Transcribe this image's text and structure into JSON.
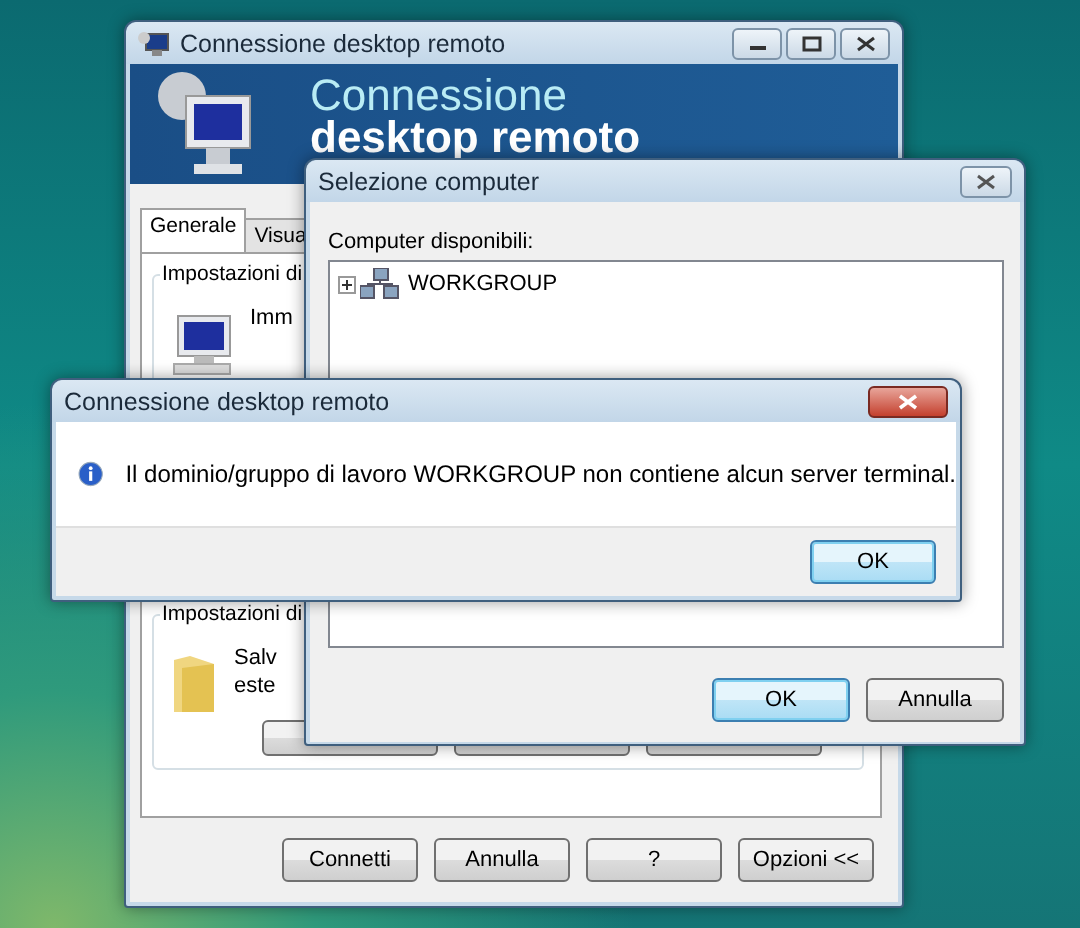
{
  "main_window": {
    "title": "Connessione desktop remoto",
    "banner": {
      "line_1": "Connessione",
      "line_2": "desktop remoto"
    },
    "tabs": [
      {
        "label": "Generale",
        "selected": true
      },
      {
        "label": "Visua",
        "selected": false
      }
    ],
    "groups": [
      {
        "label": "Impostazioni di",
        "kind": "computer",
        "texts": [
          "Imm"
        ]
      },
      {
        "label": "Impostazioni di",
        "kind": "folder",
        "texts": [
          "Salv",
          "este"
        ]
      }
    ],
    "buttons": [
      "Connetti",
      "Annulla",
      "?",
      "Opzioni <<"
    ]
  },
  "selection_dialog": {
    "title": "Selezione computer",
    "list_label": "Computer disponibili:",
    "tree": [
      {
        "label": "WORKGROUP",
        "expanded": false
      }
    ],
    "buttons": [
      {
        "label": "OK",
        "default": true
      },
      {
        "label": "Annulla",
        "default": false
      }
    ]
  },
  "message_box": {
    "title": "Connessione desktop remoto",
    "message": "Il dominio/gruppo di lavoro WORKGROUP non contiene alcun server terminal.",
    "buttons": [
      {
        "label": "OK",
        "default": true
      }
    ]
  }
}
